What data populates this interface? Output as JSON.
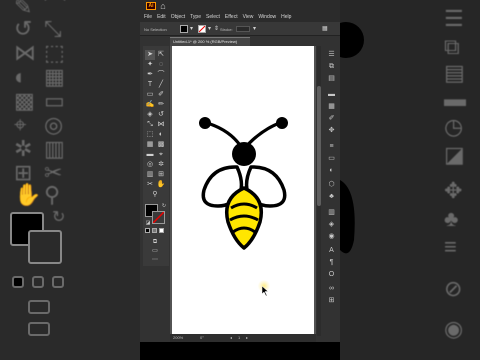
{
  "app": {
    "logo_text": "Ai",
    "menus": [
      "File",
      "Edit",
      "Object",
      "Type",
      "Select",
      "Effect",
      "View",
      "Window",
      "Help"
    ]
  },
  "control_bar": {
    "selection_text": "No Selection",
    "stroke_label": "Stroke:"
  },
  "document": {
    "tab_title": "Untitled-1* @ 200 % (RGB/Preview)",
    "zoom": "200%",
    "rotation": "0°",
    "artboard_number": "1"
  },
  "colors": {
    "bee_yellow": "#ffe600",
    "bee_outline": "#000000",
    "canvas_bg": "#535353",
    "artboard": "#ffffff",
    "app_accent": "#ff9a00"
  },
  "icons": {
    "toolbar": [
      "selection-tool-icon",
      "direct-selection-tool-icon",
      "magic-wand-icon",
      "lasso-icon",
      "pen-icon",
      "curvature-icon",
      "type-icon",
      "line-icon",
      "rectangle-icon",
      "paintbrush-icon",
      "shaper-icon",
      "pencil-icon",
      "eraser-icon",
      "rotate-icon",
      "scale-icon",
      "width-icon",
      "free-transform-icon",
      "shape-builder-icon",
      "perspective-icon",
      "mesh-icon",
      "gradient-icon",
      "eyedropper-icon",
      "blend-icon",
      "symbol-sprayer-icon",
      "graph-icon",
      "artboard-icon",
      "slice-icon",
      "hand-icon",
      "zoom-icon"
    ],
    "right_panel": [
      "properties-icon",
      "layers-icon",
      "libraries-icon",
      "color-icon",
      "swatches-icon",
      "brushes-icon",
      "symbols-icon",
      "stroke-icon",
      "gradient-panel-icon",
      "transparency-icon",
      "appearance-icon",
      "graphic-styles-icon",
      "align-icon",
      "pathfinder-icon",
      "transform-icon",
      "character-icon",
      "paragraph-icon",
      "opentype-icon",
      "links-icon",
      "artboards-panel-icon",
      "asset-export-icon",
      "navigator-icon"
    ]
  }
}
